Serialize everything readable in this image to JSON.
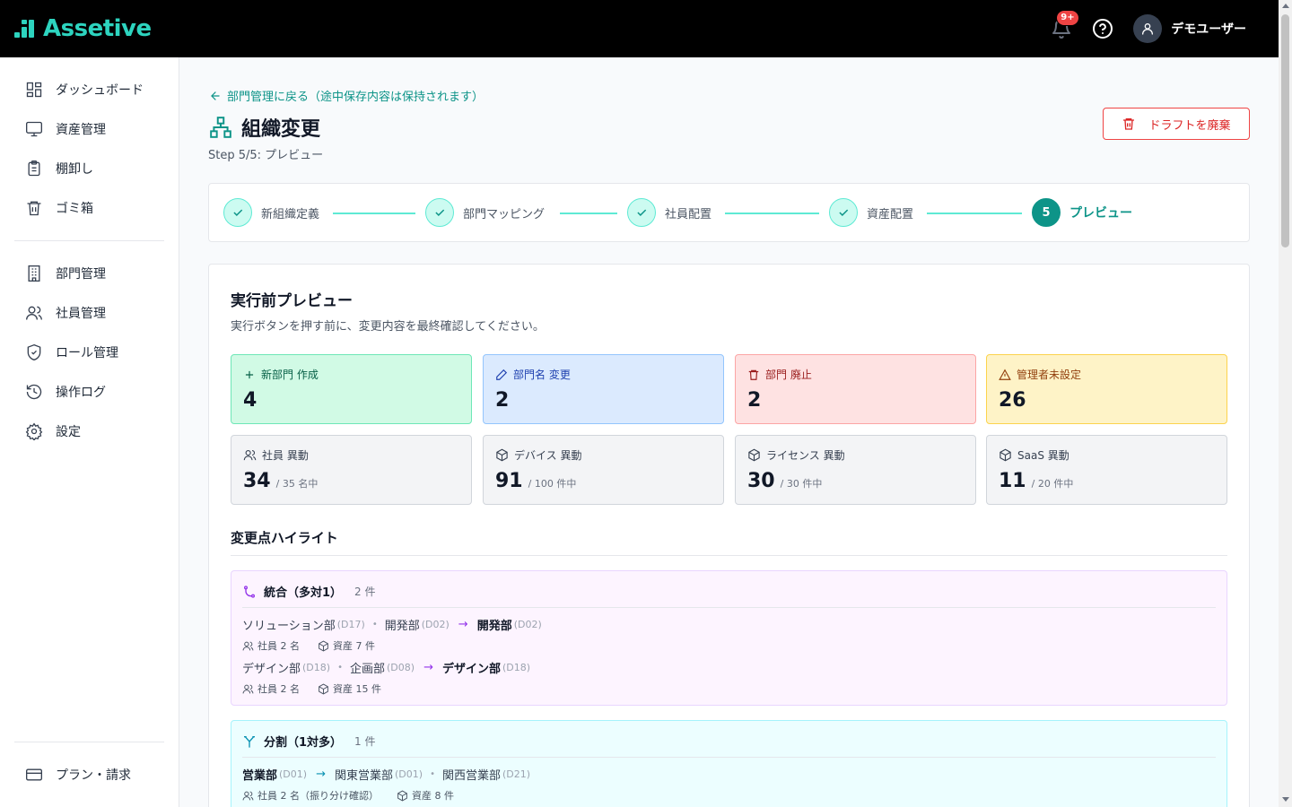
{
  "header": {
    "logo_text": "Assetive",
    "notification_badge": "9+",
    "user_name": "デモユーザー"
  },
  "sidebar": {
    "items": [
      {
        "label": "ダッシュボード",
        "icon": "dashboard-icon"
      },
      {
        "label": "資産管理",
        "icon": "monitor-icon"
      },
      {
        "label": "棚卸し",
        "icon": "clipboard-icon"
      },
      {
        "label": "ゴミ箱",
        "icon": "trash-icon"
      },
      {
        "label": "部門管理",
        "icon": "building-icon"
      },
      {
        "label": "社員管理",
        "icon": "users-icon"
      },
      {
        "label": "ロール管理",
        "icon": "shield-icon"
      },
      {
        "label": "操作ログ",
        "icon": "history-icon"
      },
      {
        "label": "設定",
        "icon": "gear-icon"
      }
    ],
    "footer_item": {
      "label": "プラン・請求",
      "icon": "credit-card-icon"
    }
  },
  "page": {
    "back_link": "部門管理に戻る（途中保存内容は保持されます）",
    "title": "組織変更",
    "step_label": "Step 5/5: プレビュー",
    "discard_button": "ドラフトを廃棄"
  },
  "stepper": {
    "steps": [
      {
        "label": "新組織定義",
        "state": "done"
      },
      {
        "label": "部門マッピング",
        "state": "done"
      },
      {
        "label": "社員配置",
        "state": "done"
      },
      {
        "label": "資産配置",
        "state": "done"
      },
      {
        "label": "プレビュー",
        "state": "active",
        "number": "5"
      }
    ]
  },
  "preview": {
    "title": "実行前プレビュー",
    "description": "実行ボタンを押す前に、変更内容を最終確認してください。",
    "summary": [
      {
        "label": "新部門 作成",
        "value": "4",
        "icon": "plus-icon"
      },
      {
        "label": "部門名 変更",
        "value": "2",
        "icon": "pencil-icon"
      },
      {
        "label": "部門 廃止",
        "value": "2",
        "icon": "trash-icon"
      },
      {
        "label": "管理者未設定",
        "value": "26",
        "icon": "warning-icon"
      }
    ],
    "transfers": [
      {
        "label": "社員 異動",
        "value": "34",
        "sub": "/ 35 名中",
        "icon": "users-icon"
      },
      {
        "label": "デバイス 異動",
        "value": "91",
        "sub": "/ 100 件中",
        "icon": "box-icon"
      },
      {
        "label": "ライセンス 異動",
        "value": "30",
        "sub": "/ 30 件中",
        "icon": "box-icon"
      },
      {
        "label": "SaaS 異動",
        "value": "11",
        "sub": "/ 20 件中",
        "icon": "box-icon"
      }
    ]
  },
  "highlights": {
    "title": "変更点ハイライト",
    "merge": {
      "title": "統合（多対1）",
      "count": "2 件",
      "rows": [
        {
          "sources": [
            {
              "name": "ソリューション部",
              "code": "(D17)"
            },
            {
              "name": "開発部",
              "code": "(D02)"
            }
          ],
          "target": {
            "name": "開発部",
            "code": "(D02)"
          },
          "employees": "社員 2 名",
          "assets": "資産 7 件"
        },
        {
          "sources": [
            {
              "name": "デザイン部",
              "code": "(D18)"
            },
            {
              "name": "企画部",
              "code": "(D08)"
            }
          ],
          "target": {
            "name": "デザイン部",
            "code": "(D18)"
          },
          "employees": "社員 2 名",
          "assets": "資産 15 件"
        }
      ]
    },
    "split": {
      "title": "分割（1対多）",
      "count": "1 件",
      "rows": [
        {
          "source": {
            "name": "営業部",
            "code": "(D01)"
          },
          "targets": [
            {
              "name": "関東営業部",
              "code": "(D01)"
            },
            {
              "name": "関西営業部",
              "code": "(D21)"
            }
          ],
          "employees": "社員 2 名（振り分け確認）",
          "assets": "資産 8 件"
        }
      ]
    }
  },
  "symbols": {
    "arrow": "→",
    "dot": "•"
  },
  "colors": {
    "brand": "#2dd4bf",
    "accent": "#0d9488",
    "danger": "#dc2626",
    "merge_accent": "#9333ea",
    "split_accent": "#0891b2"
  }
}
